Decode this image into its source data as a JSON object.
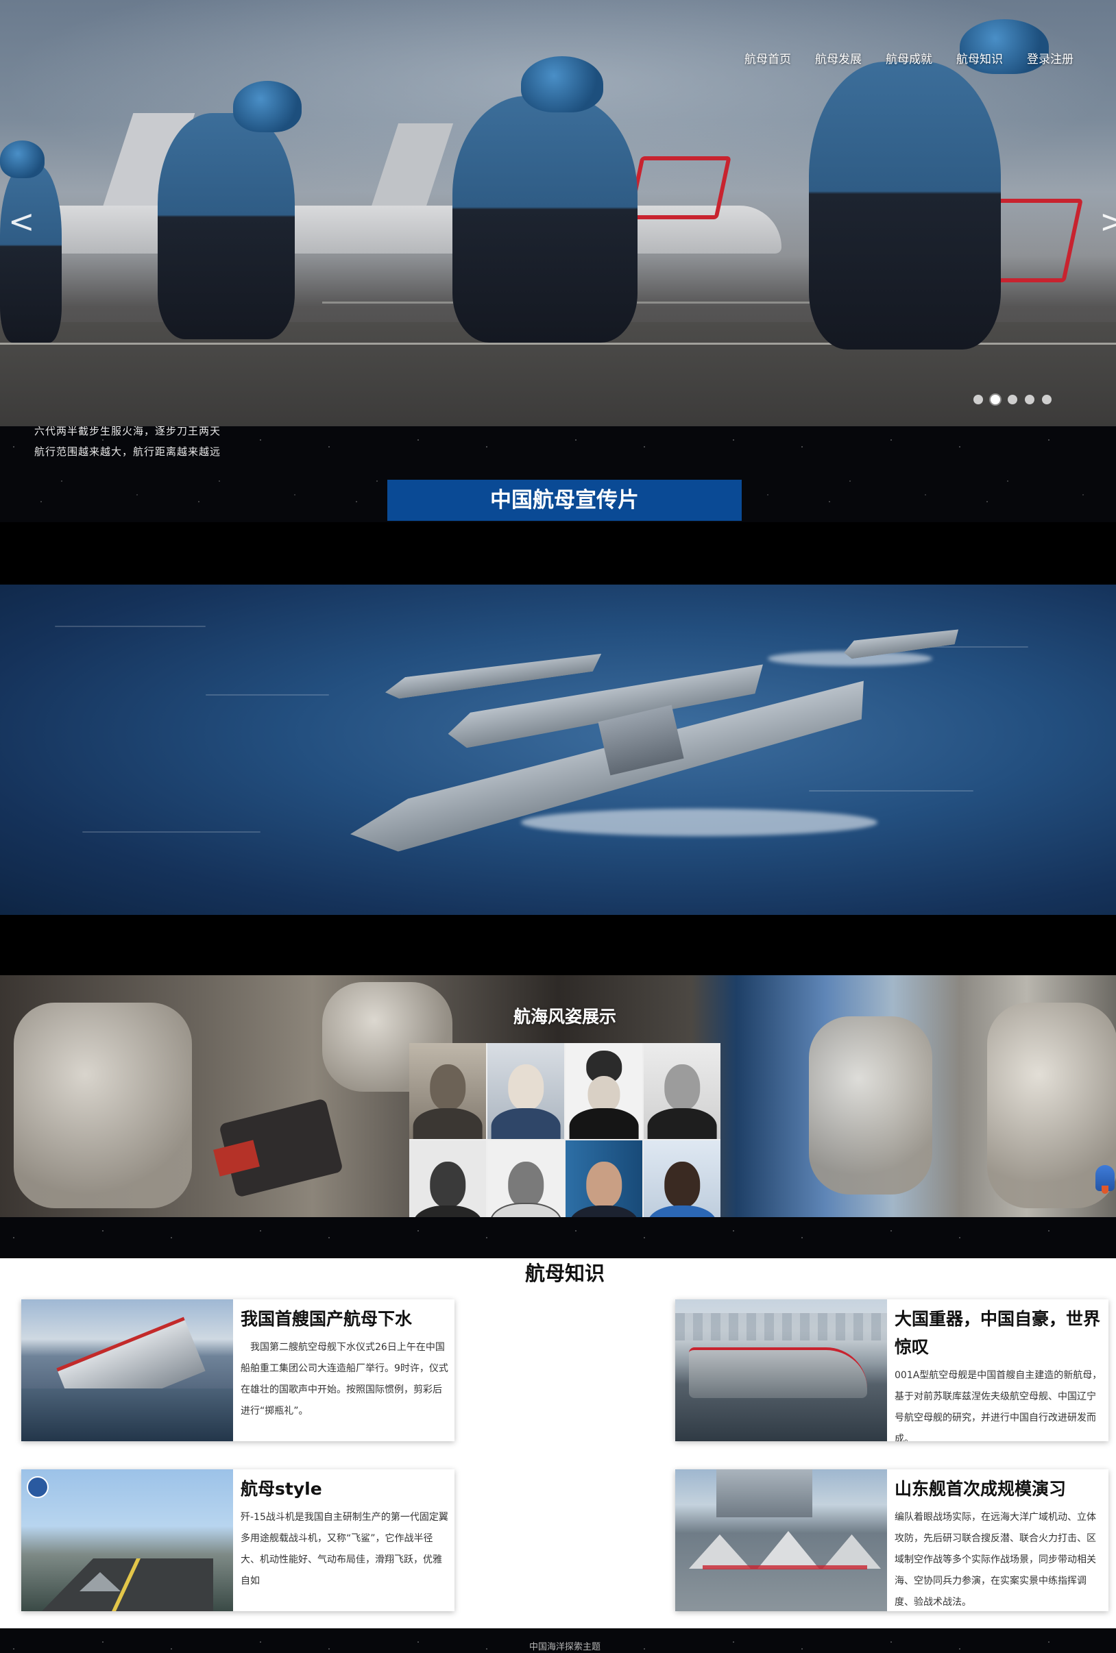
{
  "nav": {
    "items": [
      "航母首页",
      "航母发展",
      "航母成就",
      "航母知识",
      "登录注册"
    ]
  },
  "hero": {
    "prev_glyph": "<",
    "next_glyph": ">",
    "slide_count": 5,
    "active_slide": 2
  },
  "intro": {
    "line1": "六代两半截步生服火海，逐步刀王两天",
    "line2": "航行范围越来越大，航行距离越来越远"
  },
  "promo": {
    "title": "中国航母宣传片"
  },
  "gallery": {
    "title": "航海风姿展示"
  },
  "knowledge": {
    "title": "航母知识",
    "cards": [
      {
        "title": "我国首艘国产航母下水",
        "text": "　我国第二艘航空母舰下水仪式26日上午在中国船舶重工集团公司大连造船厂举行。9时许，仪式在雄壮的国歌声中开始。按照国际惯例，剪彩后进行“掷瓶礼”。"
      },
      {
        "title": "大国重器，中国自豪，世界惊叹",
        "text": "001A型航空母舰是中国首艘自主建造的新航母，基于对前苏联库兹涅佐夫级航空母舰、中国辽宁号航空母舰的研究，并进行中国自行改进研发而成。"
      },
      {
        "title": "航母style",
        "text": "歼-15战斗机是我国自主研制生产的第一代固定翼多用途舰载战斗机，又称“飞鲨”，它作战半径大、机动性能好、气动布局佳，滑翔飞跃，优雅自如"
      },
      {
        "title": "山东舰首次成规模演习",
        "text": "编队着眼战场实际，在远海大洋广域机动、立体攻防，先后研习联合搜反潜、联合火力打击、区域制空作战等多个实际作战场景，同步带动相关海、空协同兵力参演，在实案实景中练指挥调度、验战术战法。"
      }
    ]
  },
  "footer": {
    "text": "中国海洋探索主题"
  },
  "colors": {
    "banner_blue": "#0a4a95",
    "page_black": "#000000",
    "footer_text": "#b5b5b5"
  }
}
